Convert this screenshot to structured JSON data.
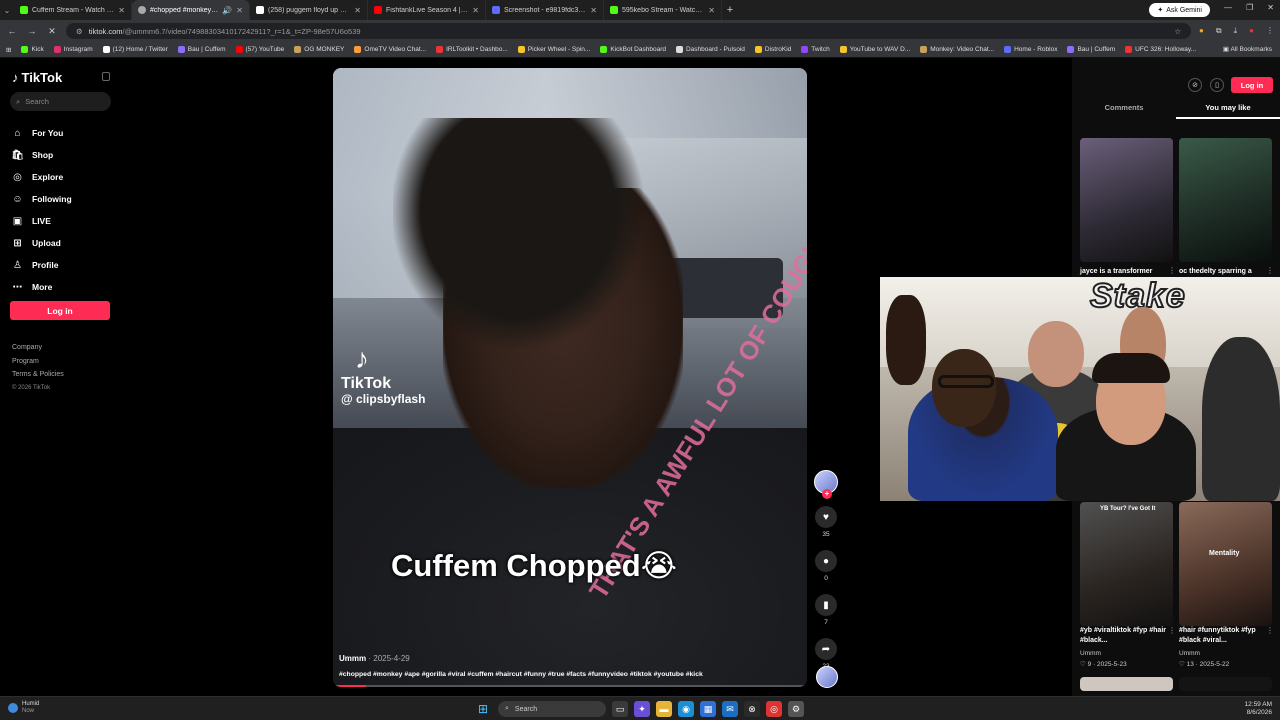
{
  "browser": {
    "tabs": [
      {
        "title": "Cuffem Stream - Watch Live on",
        "color": "#53fc18",
        "active": false
      },
      {
        "title": "#chopped #monkey #ape",
        "color": "#aaaaaa",
        "active": true
      },
      {
        "title": "(258) puggem floyd up on X: \"",
        "color": "#ffffff",
        "active": false
      },
      {
        "title": "FishtankLive Season 4 | Freddy",
        "color": "#ff0000",
        "active": false
      },
      {
        "title": "Screenshot - e9819fdc3891bc",
        "color": "#5b6cff",
        "active": false
      },
      {
        "title": "595kebo Stream - Watch Live o",
        "color": "#53fc18",
        "active": false
      }
    ],
    "ask_gemini": "Ask Gemini",
    "url_host": "tiktok.com",
    "url_rest": "/@ummm6.7/video/7498830341017242911?_r=1&_t=ZP-98e57U6o539",
    "all_bookmarks": "All Bookmarks",
    "bookmarks": [
      {
        "label": "Kick",
        "color": "#53fc18"
      },
      {
        "label": "Instagram",
        "color": "#e1306c"
      },
      {
        "label": "(12) Home / Twitter",
        "color": "#ffffff"
      },
      {
        "label": "Bau | Cuffem",
        "color": "#8d6cff"
      },
      {
        "label": "(57) YouTube",
        "color": "#ff0000"
      },
      {
        "label": "OG MONKEY",
        "color": "#c9a25a"
      },
      {
        "label": "OmeTV Video Chat...",
        "color": "#ff9b3d"
      },
      {
        "label": "IRLToolkit • Dashbo...",
        "color": "#e33"
      },
      {
        "label": "Picker Wheel - Spin...",
        "color": "#f5c52b"
      },
      {
        "label": "KickBot Dashboard",
        "color": "#53fc18"
      },
      {
        "label": "Dashboard - Pulsoid",
        "color": "#dddddd"
      },
      {
        "label": "DistroKid",
        "color": "#f5c52b"
      },
      {
        "label": "Twitch",
        "color": "#9146ff"
      },
      {
        "label": "YouTube to WAV D...",
        "color": "#f5c52b"
      },
      {
        "label": "Monkey: Video Chat...",
        "color": "#c9a25a"
      },
      {
        "label": "Home - Roblox",
        "color": "#5b6cff"
      },
      {
        "label": "Bau | Cuffem",
        "color": "#8d6cff"
      },
      {
        "label": "UFC 326: Holloway...",
        "color": "#e33"
      }
    ]
  },
  "sidebar": {
    "brand": "TikTok",
    "search_placeholder": "Search",
    "items": [
      {
        "label": "For You",
        "icon": "home-icon"
      },
      {
        "label": "Shop",
        "icon": "shop-icon"
      },
      {
        "label": "Explore",
        "icon": "compass-icon"
      },
      {
        "label": "Following",
        "icon": "user-check-icon"
      },
      {
        "label": "LIVE",
        "icon": "live-icon"
      },
      {
        "label": "Upload",
        "icon": "plus-square-icon"
      },
      {
        "label": "Profile",
        "icon": "user-icon"
      },
      {
        "label": "More",
        "icon": "dots-icon"
      }
    ],
    "login": "Log in",
    "footer": [
      "Company",
      "Program",
      "Terms & Policies"
    ],
    "copyright": "© 2026 TikTok"
  },
  "video": {
    "watermark_brand": "TikTok",
    "watermark_handle": "@ clipsbyflash",
    "caption": "Cuffem Chopped😭",
    "shirt_text": "THAT'S A AWFUL LOT OF COUGH SYRUP",
    "author": "Ummm",
    "date": "2025-4-29",
    "tags": "#chopped #monkey #ape #gorilla #viral #cuffem #haircut #funny #true #facts #funnyvideo #tiktok #youtube #kick",
    "progress": 0.07
  },
  "actions": {
    "likes": "35",
    "comments": "0",
    "saves": "7",
    "shares": "23"
  },
  "right_panel": {
    "login": "Log in",
    "tabs": [
      "Comments",
      "You may like"
    ],
    "videos": [
      {
        "caption": "jayce is a transformer",
        "user": "",
        "likes": ""
      },
      {
        "caption": "oc thedelty sparring a",
        "user": "",
        "likes": ""
      },
      {
        "caption": "#yb #viraltiktok #fyp #hair #black...",
        "overlay": "YB Tour? I've Got It",
        "user": "Ummm",
        "likes": "9",
        "date": "2025-5-23"
      },
      {
        "caption": "#hair #funnytiktok #fyp #black #viral...",
        "overlay": "Mentality",
        "user": "Ummm",
        "likes": "13",
        "date": "2025-5-22"
      }
    ]
  },
  "webcam": {
    "banner": "Stake"
  },
  "taskbar": {
    "weather_title": "Humid",
    "weather_sub": "Now",
    "search_placeholder": "Search",
    "time": "12:59 AM",
    "date": "8/6/2026"
  }
}
